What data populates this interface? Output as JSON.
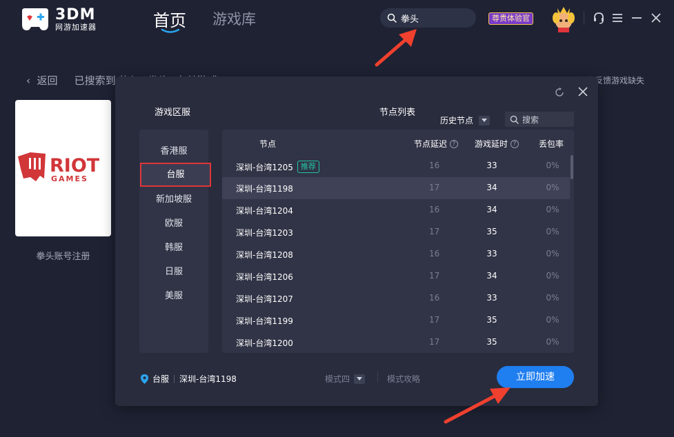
{
  "brand": {
    "name": "3DM",
    "subtitle": "网游加速器"
  },
  "nav": {
    "home": "首页",
    "library": "游戏库"
  },
  "topbar": {
    "search_value": "拳头",
    "vip_label": "尊贵体验官"
  },
  "page": {
    "back_label": "返回",
    "crumb_text": "已搜索到 热与 \"拳头\" 有关游戏",
    "feedback": "点击反馈游戏缺失",
    "game_name": "拳头账号注册",
    "game_logo": {
      "line1": "RIOT",
      "line2": "GAMES"
    }
  },
  "modal": {
    "region_title": "游戏区服",
    "node_title": "节点列表",
    "history_label": "历史节点",
    "search_placeholder": "搜索",
    "regions": [
      "香港服",
      "台服",
      "新加坡服",
      "欧服",
      "韩服",
      "日服",
      "美服"
    ],
    "active_region": "台服",
    "columns": {
      "node": "节点",
      "ping": "节点延迟",
      "game_ping": "游戏延时",
      "loss": "丢包率"
    },
    "recommend_tag": "推荐",
    "rows": [
      {
        "name": "深圳-台湾1205",
        "ping": "16",
        "game": "33",
        "loss": "0%",
        "tag": "推荐"
      },
      {
        "name": "深圳-台湾1198",
        "ping": "17",
        "game": "34",
        "loss": "0%",
        "selected": true
      },
      {
        "name": "深圳-台湾1204",
        "ping": "16",
        "game": "34",
        "loss": "0%"
      },
      {
        "name": "深圳-台湾1203",
        "ping": "17",
        "game": "35",
        "loss": "0%"
      },
      {
        "name": "深圳-台湾1208",
        "ping": "16",
        "game": "33",
        "loss": "0%"
      },
      {
        "name": "深圳-台湾1206",
        "ping": "17",
        "game": "34",
        "loss": "0%"
      },
      {
        "name": "深圳-台湾1207",
        "ping": "16",
        "game": "33",
        "loss": "0%"
      },
      {
        "name": "深圳-台湾1199",
        "ping": "17",
        "game": "35",
        "loss": "0%"
      },
      {
        "name": "深圳-台湾1200",
        "ping": "17",
        "game": "35",
        "loss": "0%"
      }
    ],
    "footer": {
      "region": "台服",
      "node": "深圳-台湾1198",
      "mode": "模式四",
      "mode_guide": "模式攻略",
      "go_button": "立即加速"
    }
  },
  "colors": {
    "accent": "#1f7ef0",
    "highlight_box": "#e0353a",
    "recommend": "#21c4a3",
    "arrow": "#f0402e"
  }
}
